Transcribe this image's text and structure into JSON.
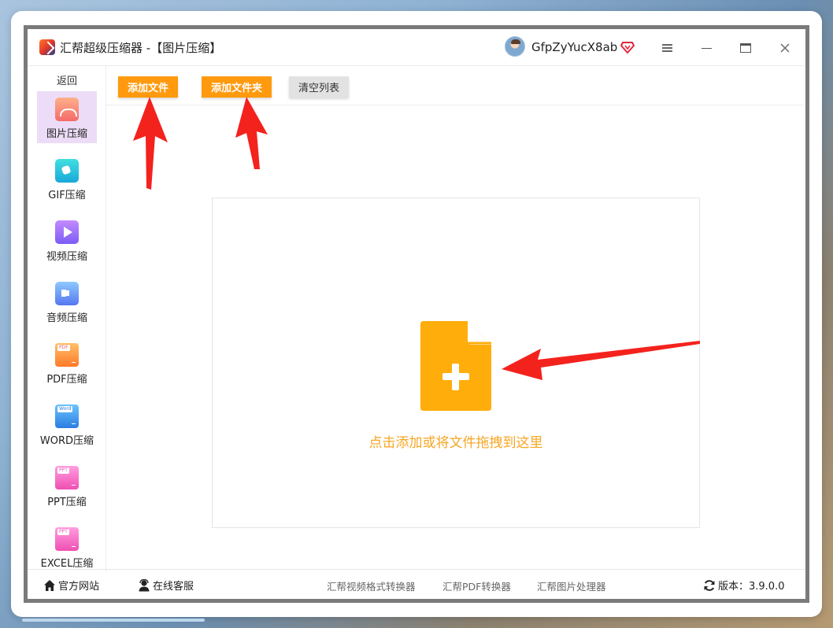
{
  "window": {
    "title": "汇帮超级压缩器",
    "subtitle": " -【图片压缩】",
    "username": "GfpZyYucX8ab"
  },
  "sidebar": {
    "back": "返回",
    "items": [
      {
        "label": "图片压缩",
        "icon": "image-compress-icon",
        "active": true
      },
      {
        "label": "GIF压缩",
        "icon": "gif-compress-icon"
      },
      {
        "label": "视频压缩",
        "icon": "video-compress-icon"
      },
      {
        "label": "音频压缩",
        "icon": "audio-compress-icon"
      },
      {
        "label": "PDF压缩",
        "icon": "pdf-compress-icon",
        "tag": "PDF"
      },
      {
        "label": "WORD压缩",
        "icon": "word-compress-icon",
        "tag": "Word"
      },
      {
        "label": "PPT压缩",
        "icon": "ppt-compress-icon",
        "tag": "PPT"
      },
      {
        "label": "EXCEL压缩",
        "icon": "excel-compress-icon",
        "tag": "PPT"
      }
    ]
  },
  "toolbar": {
    "add_file": "添加文件",
    "add_folder": "添加文件夹",
    "clear_list": "清空列表"
  },
  "dropzone": {
    "hint": "点击添加或将文件拖拽到这里"
  },
  "footer": {
    "website": "官方网站",
    "support": "在线客服",
    "links": [
      "汇帮视频格式转换器",
      "汇帮PDF转换器",
      "汇帮图片处理器"
    ],
    "version": "版本：3.9.0.0"
  },
  "colors": {
    "accent_orange": "#ff9a0e",
    "file_icon": "#ffad0a",
    "hint_text": "#f6a623",
    "active_sidebar": "#ecdcf7",
    "annotation_arrow": "#f4221d"
  }
}
